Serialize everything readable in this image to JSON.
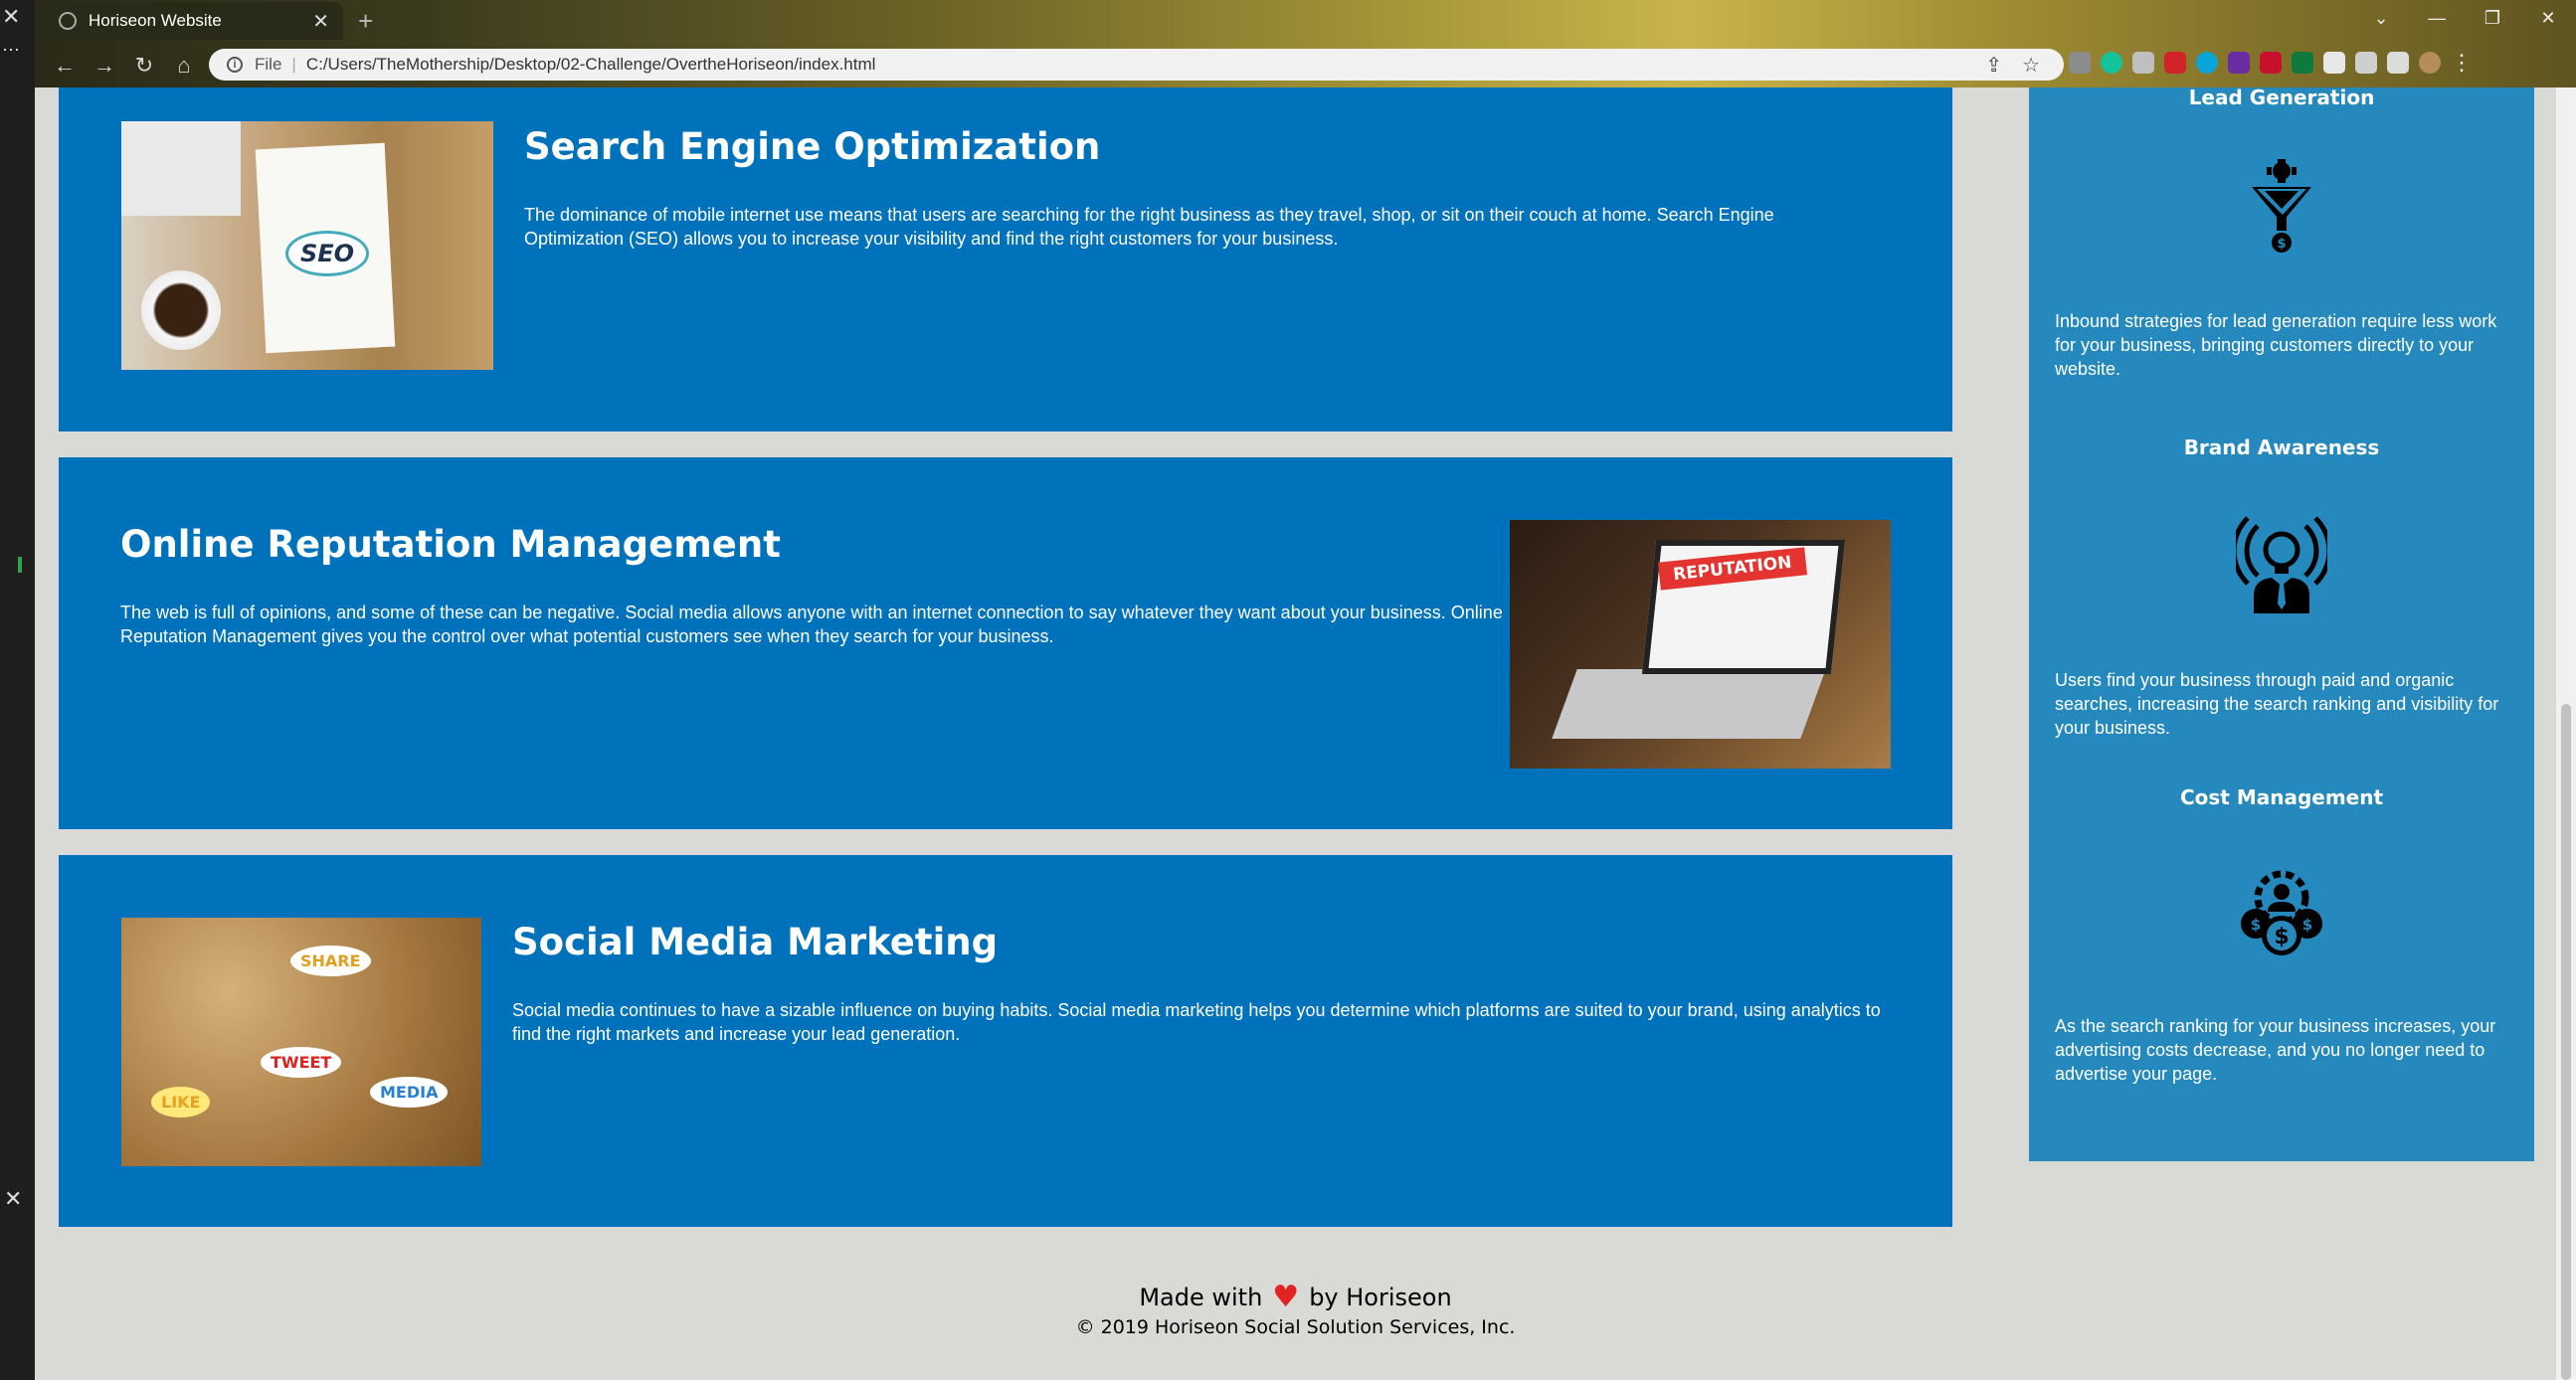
{
  "browser": {
    "tab_title": "Horiseon Website",
    "tab_close": "✕",
    "new_tab": "+",
    "address_label": "File",
    "address_url": "C:/Users/TheMothership/Desktop/02-Challenge/OvertheHoriseon/index.html",
    "window_controls": [
      "⌄",
      "—",
      "❐",
      "✕"
    ]
  },
  "services": [
    {
      "title": "Search Engine Optimization",
      "text": "The dominance of mobile internet use means that users are searching for the right business as they travel, shop, or sit on their couch at home. Search Engine Optimization (SEO) allows you to increase your visibility and find the right customers for your business.",
      "image_text": "SEO"
    },
    {
      "title": "Online Reputation Management",
      "text": "The web is full of opinions, and some of these can be negative. Social media allows anyone with an internet connection to say whatever they want about your business. Online Reputation Management gives you the control over what potential customers see when they search for your business.",
      "image_text": "REPUTATION"
    },
    {
      "title": "Social Media Marketing",
      "text": "Social media continues to have a sizable influence on buying habits. Social media marketing helps you determine which platforms are suited to your brand, using analytics to find the right markets and increase your lead generation.",
      "image_words": [
        "SHARE",
        "TWEET",
        "LIKE",
        "MEDIA"
      ]
    }
  ],
  "benefits": [
    {
      "title": "Lead Generation",
      "icon": "lead-funnel-icon",
      "text": "Inbound strategies for lead generation require less work for your business, bringing customers directly to your website."
    },
    {
      "title": "Brand Awareness",
      "icon": "lightbulb-person-icon",
      "text": "Users find your business through paid and organic searches, increasing the search ranking and visibility for your business."
    },
    {
      "title": "Cost Management",
      "icon": "cost-gear-icon",
      "text": "As the search ranking for your business increases, your advertising costs decrease, and you no longer need to advertise your page."
    }
  ],
  "footer": {
    "made_with": "Made with",
    "by": "by Horiseon",
    "copyright": "© 2019 Horiseon Social Solution Services, Inc."
  },
  "colors": {
    "service_bg": "#0072bb",
    "sidebar_bg": "#2589bd",
    "page_bg": "#d9dad6",
    "heart": "#e32222"
  }
}
